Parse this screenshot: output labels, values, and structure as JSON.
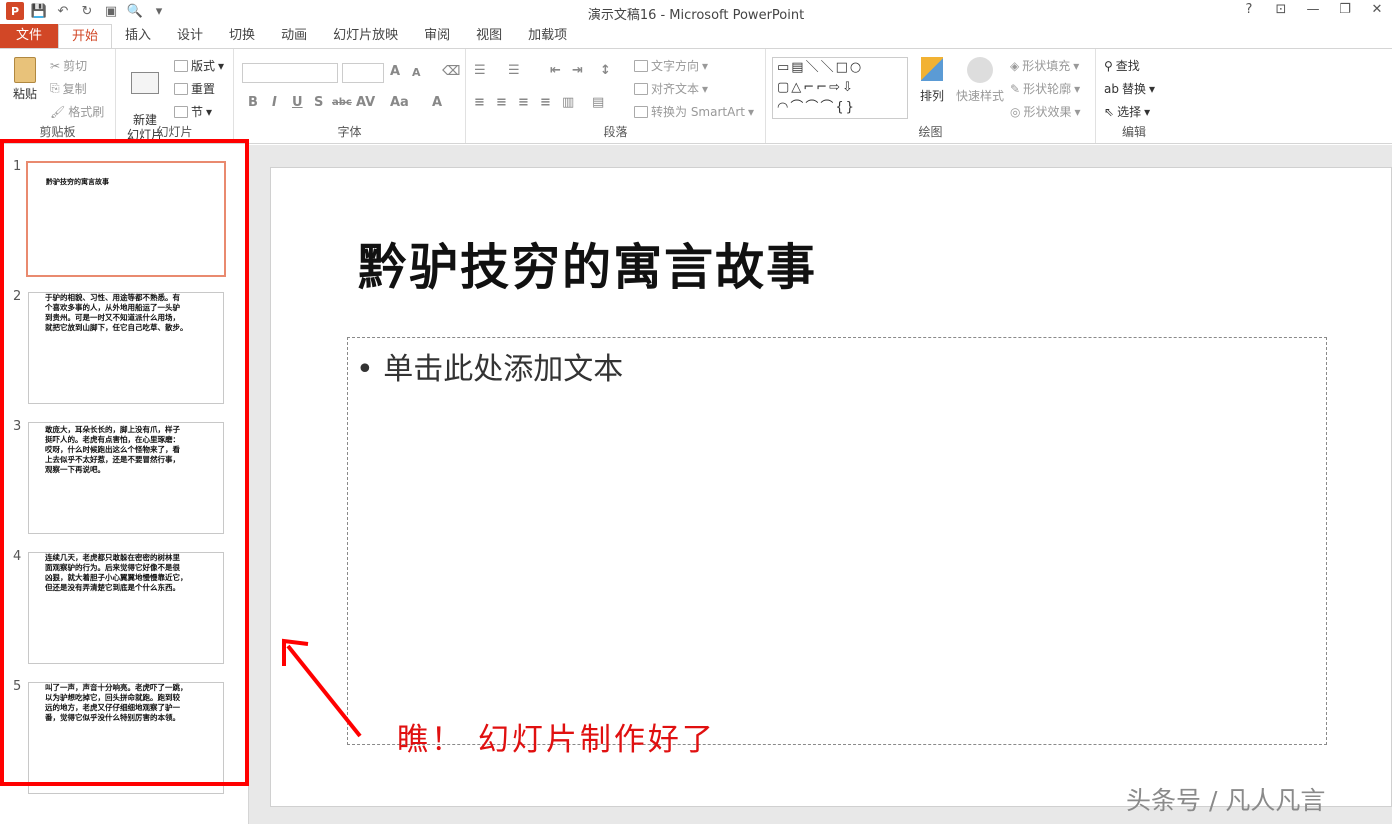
{
  "window": {
    "title": "演示文稿16 - Microsoft PowerPoint",
    "help": "?",
    "qat_logo": "P"
  },
  "tabs": [
    "文件",
    "开始",
    "插入",
    "设计",
    "切换",
    "动画",
    "幻灯片放映",
    "审阅",
    "视图",
    "加载项"
  ],
  "ribbon": {
    "clipboard": {
      "paste": "粘贴",
      "cut": "剪切",
      "copy": "复制",
      "format_painter": "格式刷",
      "label": "剪贴板"
    },
    "slides": {
      "new_slide": "新建\n幻灯片",
      "layout": "版式",
      "reset": "重置",
      "section": "节",
      "label": "幻灯片"
    },
    "font": {
      "label": "字体",
      "bold": "B",
      "italic": "I",
      "underline": "U",
      "shadow": "S",
      "strike": "abc",
      "spacing": "AV",
      "case": "Aa",
      "grow": "A",
      "shrink": "A",
      "color": "A"
    },
    "paragraph": {
      "text_direction": "文字方向",
      "align_text": "对齐文本",
      "smartart": "转换为 SmartArt",
      "label": "段落"
    },
    "drawing": {
      "arrange": "排列",
      "quick_styles": "快速样式",
      "shape_fill": "形状填充",
      "shape_outline": "形状轮廓",
      "shape_effects": "形状效果",
      "label": "绘图"
    },
    "editing": {
      "find": "查找",
      "replace": "替换",
      "select": "选择",
      "label": "编辑"
    }
  },
  "thumbnails": [
    {
      "num": "1",
      "text": "黔驴技穷的寓言故事"
    },
    {
      "num": "2",
      "text": "于驴的相貌、习性、用途等都不熟悉。有\n个喜欢多事的人，从外地用船运了一头驴\n到贵州。可是一时又不知道派什么用场，\n就把它放到山脚下，任它自己吃草、散步。"
    },
    {
      "num": "3",
      "text": "敢庞大，耳朵长长的，脚上没有爪，样子\n挺吓人的。老虎有点害怕，在心里琢磨：\n哎呀，什么时候跑出这么个怪物来了，看\n上去似乎不太好惹，还是不要冒然行事，\n观察一下再说吧。"
    },
    {
      "num": "4",
      "text": "连续几天，老虎都只敢躲在密密的树林里\n面观察驴的行为。后来觉得它好像不是很\n凶狠，就大着胆子小心翼翼地慢慢靠近它，\n但还是没有弄清楚它到底是个什么东西。"
    },
    {
      "num": "5",
      "text": "叫了一声，声音十分响亮。老虎吓了一跳，\n以为驴想吃掉它，回头拼命就跑。跑到较\n远的地方，老虎又仔仔细细地观察了驴一\n番，觉得它似乎没什么特别厉害的本领。"
    }
  ],
  "slide": {
    "title": "黔驴技穷的寓言故事",
    "placeholder": "单击此处添加文本",
    "bullet": "•"
  },
  "annotation": "瞧！ 幻灯片制作好了",
  "watermark": "头条号 / 凡人凡言",
  "colors": {
    "accent": "#d24726",
    "highlight_box": "#ff0000",
    "annotation": "#e01010"
  }
}
